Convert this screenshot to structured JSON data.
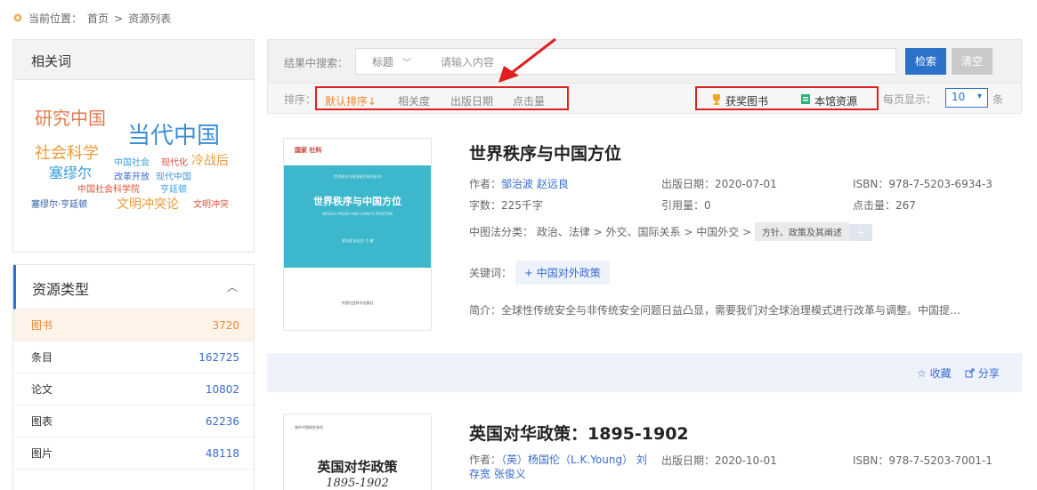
{
  "breadcrumb": {
    "prefix": "当前位置：",
    "home": "首页",
    "sep": ">",
    "current": "资源列表"
  },
  "related": {
    "title": "相关词",
    "words": [
      {
        "text": "研究中国",
        "color": "#e57a4e"
      },
      {
        "text": "当代中国",
        "color": "#3a8fd6"
      },
      {
        "text": "社会科学",
        "color": "#ec9b3a"
      },
      {
        "text": "塞缪尔",
        "color": "#3a9bd6"
      },
      {
        "text": "中国社会",
        "color": "#3aa0e0"
      },
      {
        "text": "现代化",
        "color": "#e0503a"
      },
      {
        "text": "冷战后",
        "color": "#ec9b3a"
      },
      {
        "text": "改革开放",
        "color": "#3a6bd0"
      },
      {
        "text": "现代中国",
        "color": "#3a9bd6"
      },
      {
        "text": "中国社会科学院",
        "color": "#e0503a"
      },
      {
        "text": "亨廷顿",
        "color": "#3aa0e0"
      },
      {
        "text": "塞缪尔·亨廷顿",
        "color": "#2d5aa8"
      },
      {
        "text": "文明冲突论",
        "color": "#ec9b3a"
      },
      {
        "text": "文明冲突",
        "color": "#e0503a"
      }
    ]
  },
  "resource_types": {
    "title": "资源类型",
    "items": [
      {
        "label": "图书",
        "count": "3720"
      },
      {
        "label": "条目",
        "count": "162725"
      },
      {
        "label": "论文",
        "count": "10802"
      },
      {
        "label": "图表",
        "count": "62236"
      },
      {
        "label": "图片",
        "count": "48118"
      }
    ]
  },
  "search": {
    "label": "结果中搜索：",
    "field_select": "标题",
    "placeholder": "请输入内容",
    "search_button": "检索",
    "clear_button": "清空"
  },
  "sort": {
    "label": "排序：",
    "options": [
      "默认排序↓",
      "相关度",
      "出版日期",
      "点击量"
    ],
    "filter_award": "获奖图书",
    "filter_local": "本馆资源",
    "per_page_label": "每页显示：",
    "per_page_value": "10",
    "per_page_unit": "条"
  },
  "results": [
    {
      "title": "世界秩序与中国方位",
      "author_label": "作者：",
      "authors": "邹治波   赵远良",
      "pubdate": "出版日期：2020-07-01",
      "isbn": "ISBN：978-7-5203-6934-3",
      "words": "字数：225千字",
      "cited": "引用量：0",
      "clicks": "点击量：267",
      "clc_label": "中图法分类：",
      "clc_path": "政治、法律 > 外交、国际关系 > 中国外交 >",
      "clc_tag": "方针、政策及其阐述",
      "clc_more": "+",
      "keyword_label": "关键词：",
      "keyword": "+ 中国对外政策",
      "abstract": "简介：全球性传统安全与非传统安全问题日益凸显，需要我们对全球治理模式进行改革与调整。中国提…",
      "cover": {
        "publisher_mark": "国家 社科",
        "series": "（世界经济与政治研究系列丛书）",
        "title": "世界秩序与中国方位",
        "subtitle": "WORLD ORDER AND CHINA'S POSITION",
        "authors": "邹治波  赵远良 主 编",
        "press": "中国社会科学出版社"
      }
    },
    {
      "title": "英国对华政策：1895-1902",
      "author_label": "作者：",
      "authors": "（英）杨国伦（L.K.Young）  刘存宽  张俊义",
      "pubdate": "出版日期：2020-10-01",
      "isbn": "ISBN：978-7-5203-7001-1",
      "cover": {
        "series": "海外中国研究系列",
        "title": "英国对华政策",
        "subtitle": "1895-1902"
      }
    }
  ],
  "actions": {
    "favorite": "☆ 收藏",
    "share": "分享"
  },
  "colors": {
    "accent": "#2d72c9",
    "orange": "#ec8a35",
    "highlight_box": "#e02020",
    "cover_teal": "#3cb7cc"
  }
}
